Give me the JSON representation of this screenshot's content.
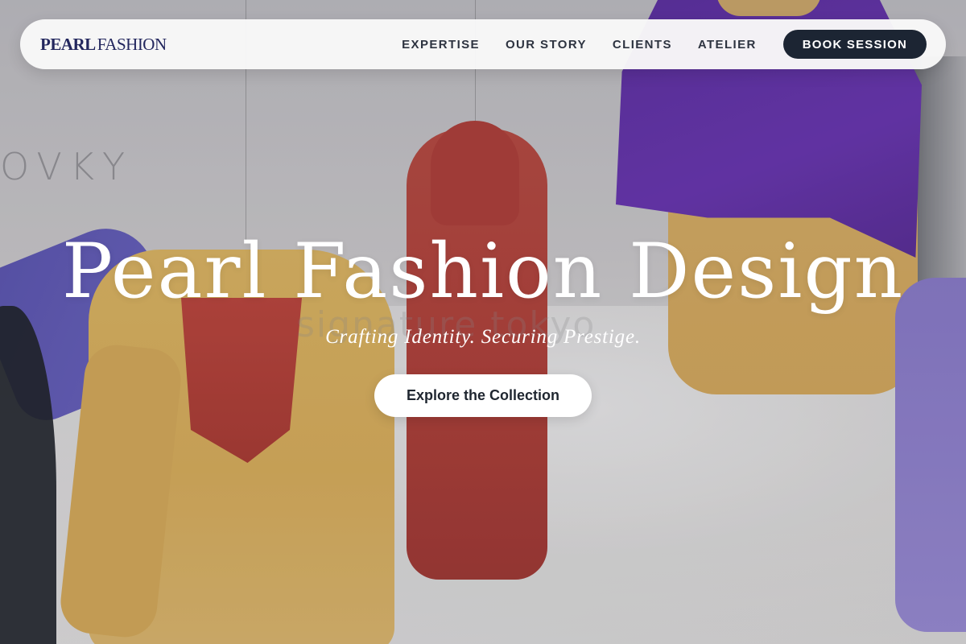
{
  "brand": {
    "logo_primary": "PEARL",
    "logo_secondary": "FASHION",
    "color_navy": "#23275e"
  },
  "nav": {
    "links": [
      {
        "label": "EXPERTISE"
      },
      {
        "label": "OUR STORY"
      },
      {
        "label": "CLIENTS"
      },
      {
        "label": "ATELIER"
      }
    ],
    "cta_label": "BOOK SESSION",
    "cta_color": "#1c2533"
  },
  "hero": {
    "title": "Pearl Fashion Design",
    "subtitle": "Crafting Identity. Securing Prestige.",
    "button_label": "Explore the Collection",
    "background_wall_text": "OVKY",
    "background_watermark": "signature tokyo"
  }
}
